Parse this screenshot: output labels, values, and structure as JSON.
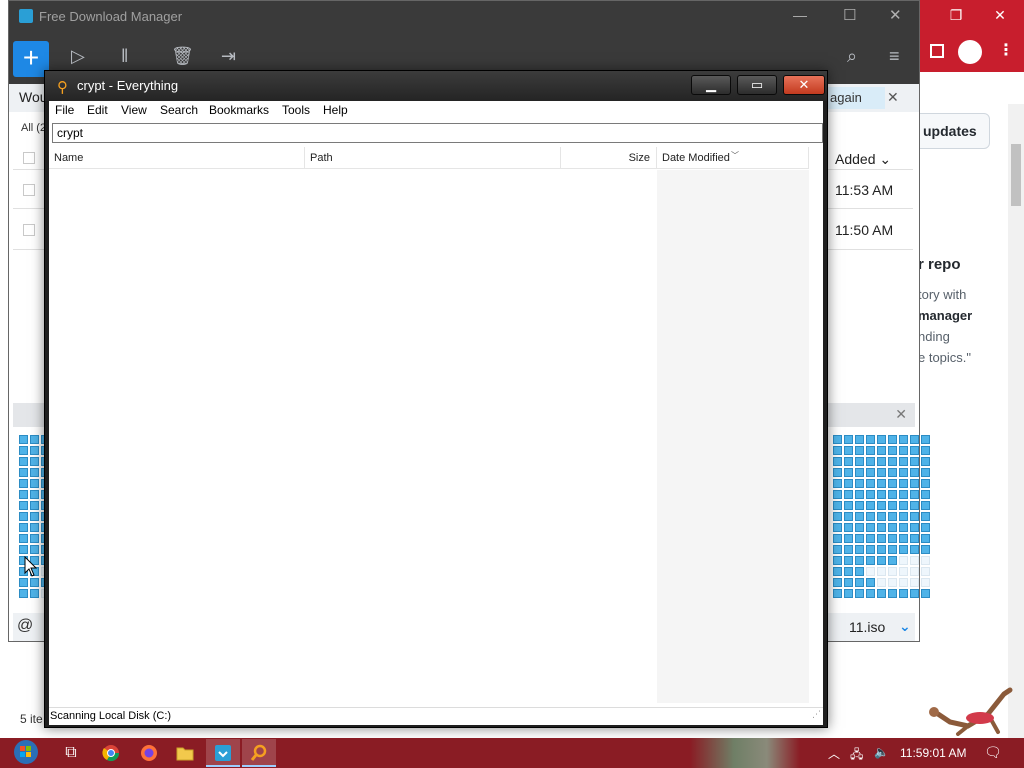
{
  "browser": {
    "buttons": {
      "restore": "❐",
      "close": "✕"
    },
    "page": {
      "updates_label": "updates",
      "repo_heading": "r repo",
      "line1": "tory with",
      "line2": "manager",
      "line3": "nding",
      "line4": "e topics.\""
    }
  },
  "fdm": {
    "title": "Free Download Manager",
    "title_buttons": {
      "minimize": "—",
      "maximize": "☐",
      "close": "✕"
    },
    "tab_text": "Wou",
    "filter_text": "All (2",
    "again_label": "again",
    "dismiss_label": "✕",
    "added_header": "Added ⌄",
    "row_times": [
      "11:53 AM",
      "11:50 AM"
    ],
    "file_label": "11.iso",
    "status_text": "5 ite"
  },
  "everything": {
    "title": "crypt - Everything",
    "title_buttons": {
      "minimize": "▁",
      "maximize": "▭",
      "close": "✕"
    },
    "menu": [
      "File",
      "Edit",
      "View",
      "Search",
      "Bookmarks",
      "Tools",
      "Help"
    ],
    "search_value": "crypt",
    "columns": [
      "Name",
      "Path",
      "Size",
      "Date Modified"
    ],
    "status": "Scanning Local Disk (C:)"
  },
  "taskbar": {
    "clock": "11:59:01 AM",
    "items": [
      "task-view",
      "chrome",
      "firefox",
      "file-explorer",
      "free-download-manager",
      "everything"
    ]
  },
  "colors": {
    "taskbar": "#8a1c24",
    "fdm_accent": "#1e88e5",
    "everything_close": "#c23a1f",
    "fdm_piece": "#4fb3e8"
  }
}
